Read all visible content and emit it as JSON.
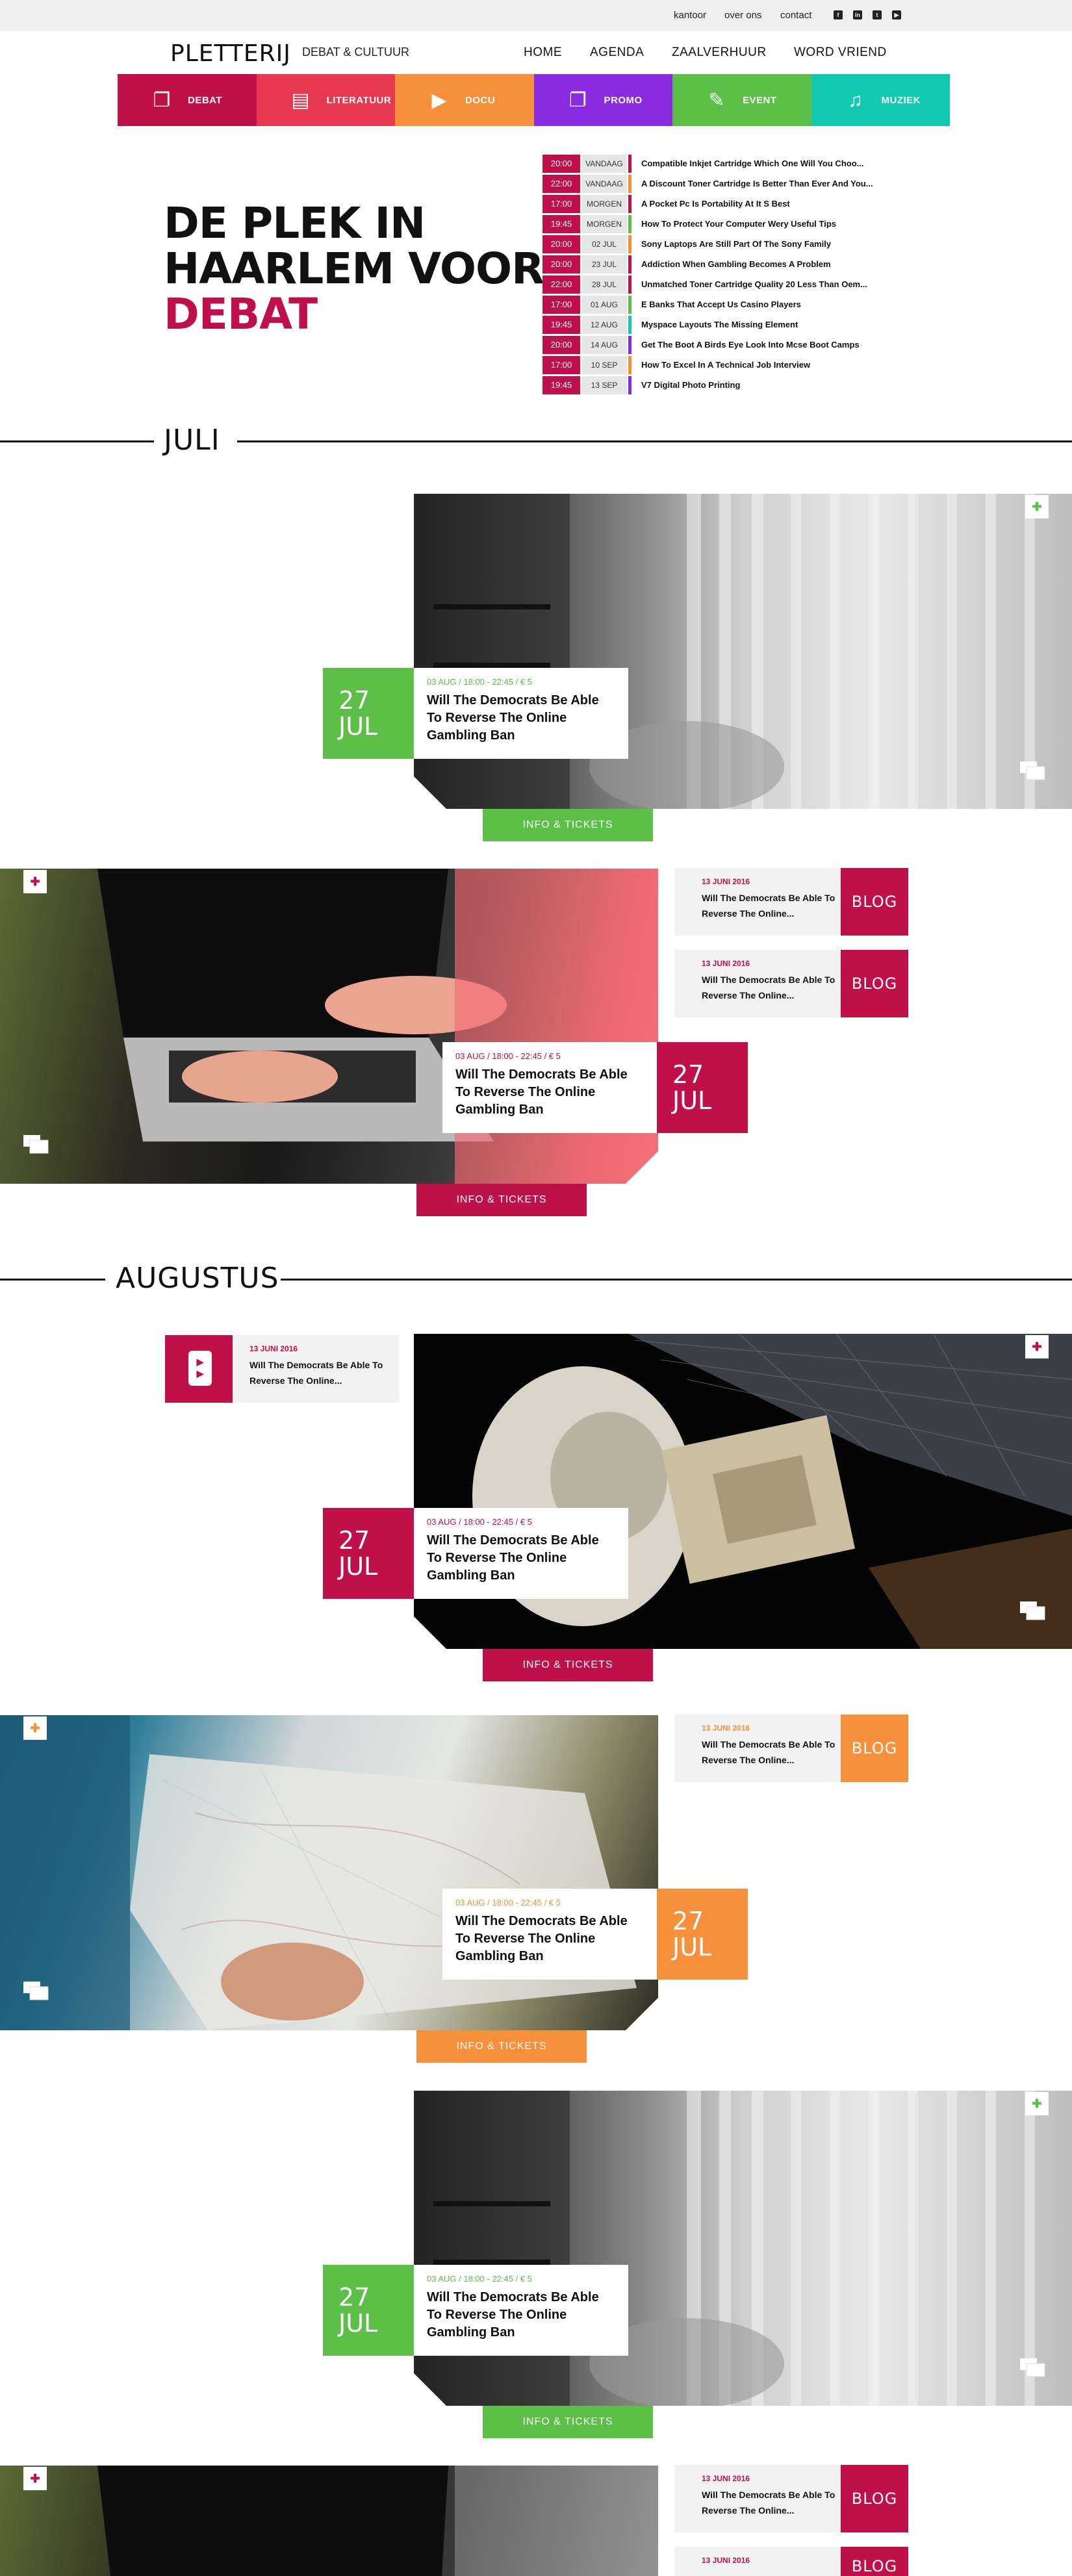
{
  "topbar": {
    "links": [
      "kantoor",
      "over ons",
      "contact"
    ],
    "social": [
      "facebook-icon",
      "linkedin-icon",
      "twitter-icon",
      "youtube-icon"
    ]
  },
  "header": {
    "logo": "PLETTERIJ",
    "tagline": "DEBAT & CULTUUR",
    "nav": [
      "HOME",
      "AGENDA",
      "ZAALVERHUUR",
      "WORD VRIEND"
    ]
  },
  "categories": [
    {
      "label": "DEBAT",
      "color": "#c0104a",
      "icon": "chat-icon"
    },
    {
      "label": "LITERATUUR",
      "color": "#e8384f",
      "icon": "book-icon"
    },
    {
      "label": "DOCU",
      "color": "#f7903a",
      "icon": "play-icon"
    },
    {
      "label": "PROMO",
      "color": "#8a2be2",
      "icon": "chat-icon"
    },
    {
      "label": "EVENT",
      "color": "#5cbf47",
      "icon": "ticket-icon"
    },
    {
      "label": "MUZIEK",
      "color": "#13c8b0",
      "icon": "music-icon"
    }
  ],
  "hero": {
    "line1": "DE PLEK IN",
    "line2": "HAARLEM VOOR",
    "line3": "DEBAT"
  },
  "agenda": [
    {
      "time": "20:00",
      "date": "VANDAAG",
      "title": "Compatible Inkjet Cartridge Which One Will You Choo...",
      "color": "#c0104a"
    },
    {
      "time": "22:00",
      "date": "VANDAAG",
      "title": "A Discount Toner Cartridge Is Better Than Ever And You...",
      "color": "#f7903a"
    },
    {
      "time": "17:00",
      "date": "MORGEN",
      "title": "A Pocket Pc Is Portability At It S Best",
      "color": "#c0104a"
    },
    {
      "time": "19:45",
      "date": "MORGEN",
      "title": "How To Protect Your Computer Wery Useful Tips",
      "color": "#5cbf47"
    },
    {
      "time": "20:00",
      "date": "02 JUL",
      "title": "Sony Laptops Are Still Part Of The Sony Family",
      "color": "#f7903a"
    },
    {
      "time": "20:00",
      "date": "23 JUL",
      "title": "Addiction When Gambling Becomes A Problem",
      "color": "#c0104a"
    },
    {
      "time": "22:00",
      "date": "28 JUL",
      "title": "Unmatched Toner Cartridge Quality 20 Less Than Oem...",
      "color": "#c0104a"
    },
    {
      "time": "17:00",
      "date": "01 AUG",
      "title": "E Banks That Accept Us Casino Players",
      "color": "#5cbf47"
    },
    {
      "time": "19:45",
      "date": "12 AUG",
      "title": "Myspace Layouts The Missing Element",
      "color": "#13c8b0"
    },
    {
      "time": "20:00",
      "date": "14 AUG",
      "title": "Get The Boot A Birds Eye Look Into Mcse Boot Camps",
      "color": "#8a2be2"
    },
    {
      "time": "17:00",
      "date": "10 SEP",
      "title": "How To Excel In A Technical Job Interview",
      "color": "#f7903a"
    },
    {
      "time": "19:45",
      "date": "13 SEP",
      "title": "V7 Digital Photo Printing",
      "color": "#8a2be2"
    }
  ],
  "months": {
    "july": "JULI",
    "august": "AUGUSTUS"
  },
  "event": {
    "meta": "03 AUG / 18:00 - 22:45 / € 5",
    "title": "Will The Democrats Be Able To Reverse The Online Gambling Ban",
    "day": "27",
    "month": "JUL",
    "button": "INFO & TICKETS"
  },
  "teaser": {
    "date": "13 JUNI 2016",
    "title": "Will The Democrats Be Able To Reverse The Online...",
    "badge": "BLOG"
  },
  "colors": {
    "green": "#5cbf47",
    "red": "#c0104a",
    "orange": "#f7903a"
  }
}
